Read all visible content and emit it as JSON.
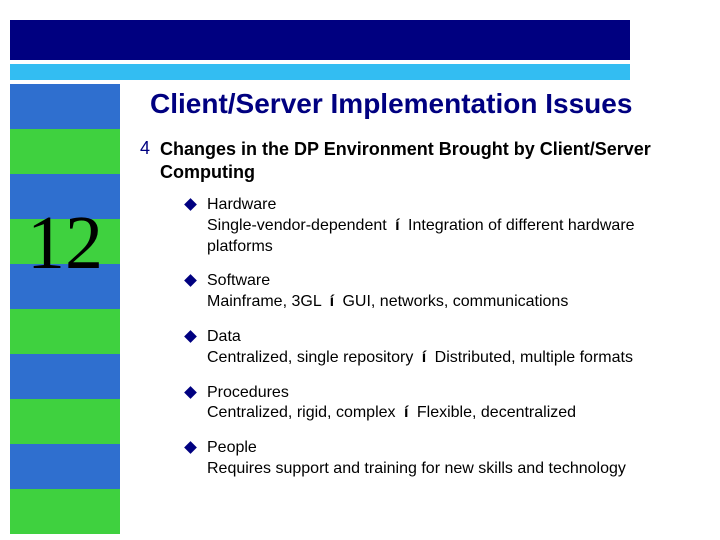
{
  "chapter_number": "12",
  "title": "Client/Server Implementation Issues",
  "lvl1_bullet_glyph": "4",
  "main_point": "Changes in the DP Environment Brought by Client/Server Computing",
  "arrow_glyph": "í",
  "sub_points": [
    {
      "heading": "Hardware",
      "from": "Single-vendor-dependent",
      "to": "Integration of different hardware platforms"
    },
    {
      "heading": "Software",
      "from": "Mainframe, 3GL",
      "to": "GUI, networks, communications"
    },
    {
      "heading": "Data",
      "from": "Centralized, single repository",
      "to": "Distributed, multiple formats"
    },
    {
      "heading": "Procedures",
      "from": "Centralized, rigid, complex",
      "to": "Flexible, decentralized"
    },
    {
      "heading": "People",
      "plain": "Requires support and training for new skills and technology"
    }
  ],
  "colors": {
    "navy": "#000080",
    "stripe_blue": "#2F6FCF",
    "stripe_green": "#3FD13F",
    "thin_bar": "#33BDF2"
  }
}
